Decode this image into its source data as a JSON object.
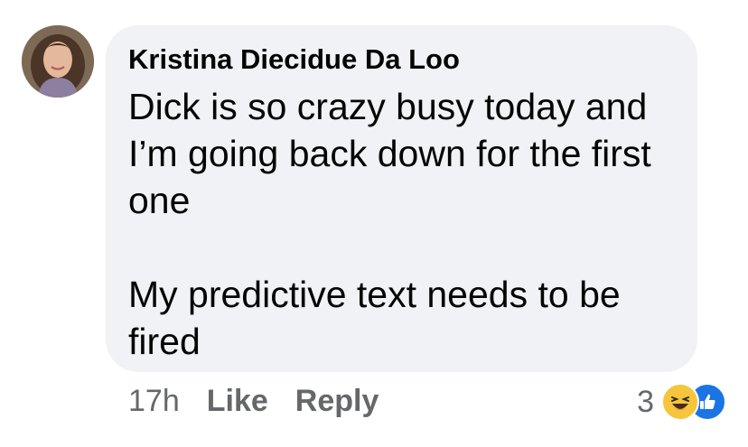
{
  "comment": {
    "author": "Kristina Diecidue Da Loo",
    "message_lines": [
      "Dick is so crazy busy today and",
      "I’m going back down for the first",
      "one",
      "",
      "My predictive text needs to be",
      "fired"
    ],
    "timestamp": "17h",
    "like_label": "Like",
    "reply_label": "Reply",
    "reaction_count": "3",
    "reaction_icons": [
      "haha-icon",
      "like-reaction-icon"
    ]
  },
  "colors": {
    "bubble": "#f0f2f5",
    "text": "#050505",
    "secondary_text": "#65676b",
    "like_blue": "#1b74e4",
    "haha_yellow": "#f7c53b"
  }
}
